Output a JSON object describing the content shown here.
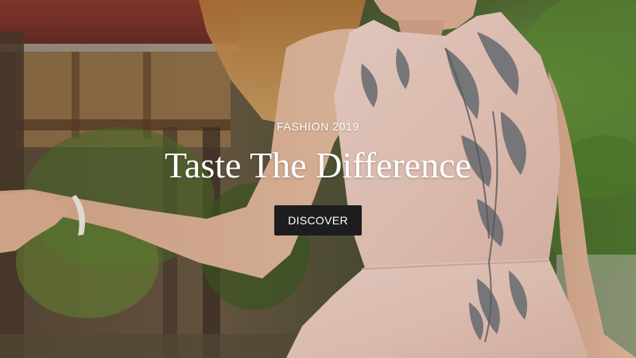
{
  "hero": {
    "eyebrow": "FASHION 2019",
    "title": "Taste The Difference",
    "cta_label": "DISCOVER",
    "image_description_icon": "photo-background",
    "colors": {
      "cta_background": "#1d1d1f",
      "text": "#ffffff"
    }
  }
}
